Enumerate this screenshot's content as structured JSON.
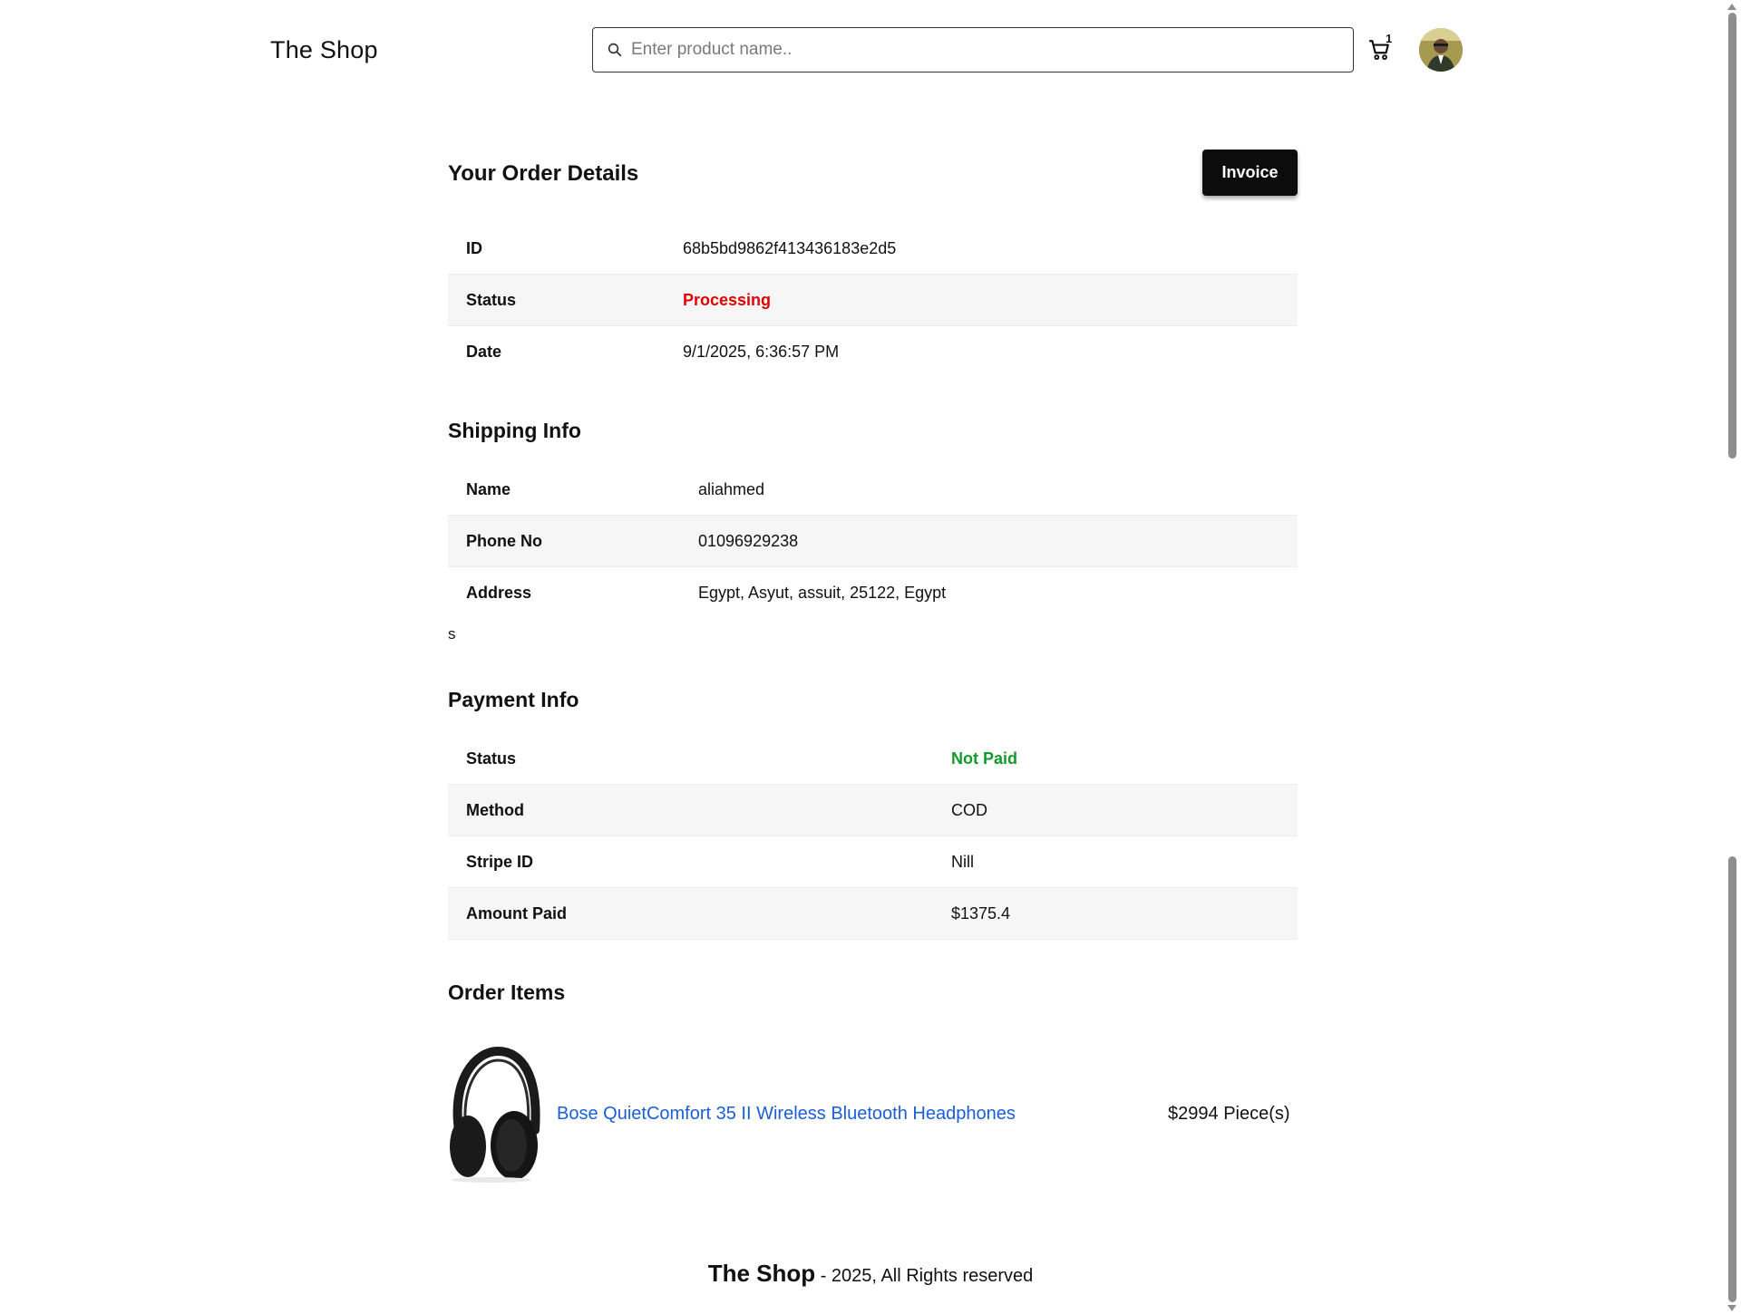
{
  "header": {
    "brand": "The Shop",
    "search_placeholder": "Enter product name..",
    "cart_count": "1"
  },
  "order": {
    "title": "Your Order Details",
    "invoice_label": "Invoice",
    "rows": [
      {
        "label": "ID",
        "value": "68b5bd9862f413436183e2d5"
      },
      {
        "label": "Status",
        "value": "Processing"
      },
      {
        "label": "Date",
        "value": "9/1/2025, 6:36:57 PM"
      }
    ]
  },
  "shipping": {
    "title": "Shipping Info",
    "rows": [
      {
        "label": "Name",
        "value": "aliahmed"
      },
      {
        "label": "Phone No",
        "value": "01096929238"
      },
      {
        "label": "Address",
        "value": "Egypt, Asyut, assuit, 25122, Egypt"
      }
    ],
    "stray_text": "s"
  },
  "payment": {
    "title": "Payment Info",
    "rows": [
      {
        "label": "Status",
        "value": "Not Paid"
      },
      {
        "label": "Method",
        "value": "COD"
      },
      {
        "label": "Stripe ID",
        "value": "Nill"
      },
      {
        "label": "Amount Paid",
        "value": "$1375.4"
      }
    ]
  },
  "items": {
    "title": "Order Items",
    "list": [
      {
        "name": "Bose QuietComfort 35 II Wireless Bluetooth Headphones",
        "price": "$2994",
        "qty": "Piece(s)"
      }
    ]
  },
  "footer": {
    "brand": "The Shop",
    "text": "- 2025, All Rights reserved"
  },
  "colors": {
    "status_processing": "#e00000",
    "status_not_paid": "#129a2c",
    "link": "#1a5fd6",
    "button_bg": "#0c0c0c"
  },
  "icons": [
    "search-icon",
    "cart-icon",
    "avatar",
    "headphones-image"
  ]
}
